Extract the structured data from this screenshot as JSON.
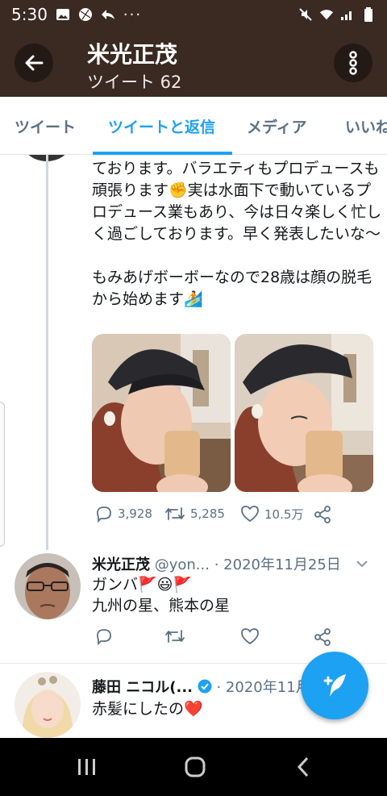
{
  "status_bar": {
    "time": "5:30",
    "dots": "···"
  },
  "header": {
    "title": "米光正茂",
    "subtitle": "ツイート 62"
  },
  "tabs": [
    {
      "label": "ツイート"
    },
    {
      "label": "ツイートと返信"
    },
    {
      "label": "メディア"
    },
    {
      "label": "いいね"
    }
  ],
  "tweet1": {
    "paragraph1": "ております。バラエティもプロデュースも頑張ります✊実は水面下で動いているプロデュース業もあり、今は日々楽しく忙しく過ごしております。早く発表したいな〜",
    "paragraph2": "もみあげボーボーなので28歳は顔の脱毛から始めます🏄",
    "replies": "3,928",
    "retweets": "5,285",
    "likes": "10.5万"
  },
  "tweet2": {
    "name": "米光正茂",
    "handle": "@yon...",
    "date": "· 2020年11月25日",
    "line1": "ガンバ🚩😃🚩",
    "line2": "九州の星、熊本の星"
  },
  "tweet3": {
    "name": "藤田 ニコル(...",
    "date": "· 2020年11月",
    "line1": "赤髪にしたの❤️"
  },
  "colors": {
    "accent": "#1da1f2",
    "header_bg": "#3a2a22",
    "muted": "#5b7083"
  },
  "icons": [
    "back-arrow-icon",
    "more-vertical-icon",
    "reply-icon",
    "retweet-icon",
    "like-icon",
    "share-icon",
    "compose-icon",
    "verified-icon"
  ]
}
